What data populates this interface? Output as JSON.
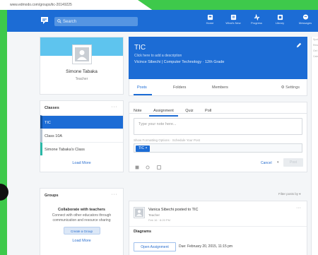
{
  "browser": {
    "url": "www.edmodo.com/groups/tic-20149225"
  },
  "topnav": {
    "search_placeholder": "Search",
    "items": [
      {
        "label": "Home",
        "icon": "home-icon"
      },
      {
        "label": "What's New",
        "icon": "whats-new-icon"
      },
      {
        "label": "Progress",
        "icon": "progress-icon"
      },
      {
        "label": "Library",
        "icon": "library-icon"
      },
      {
        "label": "Messages",
        "icon": "messages-icon"
      }
    ]
  },
  "profile": {
    "name": "Simone Tabaka",
    "role": "Teacher"
  },
  "classes": {
    "title": "Classes",
    "items": [
      "TIC",
      "Class 10A",
      "Simone Tabaka's Class"
    ],
    "load_more": "Load More"
  },
  "groups": {
    "title": "Groups",
    "headline": "Collaborate with teachers",
    "description": "Connect with other educators through communication and resource sharing",
    "create_label": "Create a Group",
    "load_more": "Load More"
  },
  "group_header": {
    "title": "TIC",
    "subtitle": "Click here to add a description",
    "meta": "Vicince Sibechi | Computer Technology · 12th Grade"
  },
  "tabs": {
    "posts": "Posts",
    "folders": "Folders",
    "members": "Members",
    "settings": "Settings"
  },
  "composer": {
    "tabs": [
      "Note",
      "Assignment",
      "Quiz",
      "Poll"
    ],
    "placeholder": "Type your note here...",
    "helper": "Show Formatting Options · Schedule Your Post",
    "recipient": "TIC",
    "cancel": "Cancel",
    "post_label": "Post"
  },
  "feed": {
    "filter_label": "Filter posts by ▾"
  },
  "post": {
    "author": "Vanica Sibechi posted to TIC",
    "role": "Teacher",
    "date": "Feb 16 · 8:20 PM",
    "title": "Diagrams",
    "open_label": "Open Assignment",
    "due": "Due: February 20, 2015, 11:15 pm"
  },
  "right_sidebar": {
    "lines": [
      "Spotlight",
      "Resources",
      "Get the app",
      "Calendar"
    ]
  },
  "colors": {
    "brand_blue": "#1c6cd5",
    "banner_cyan": "#5ec4ee",
    "border_green": "#3ec94b"
  }
}
